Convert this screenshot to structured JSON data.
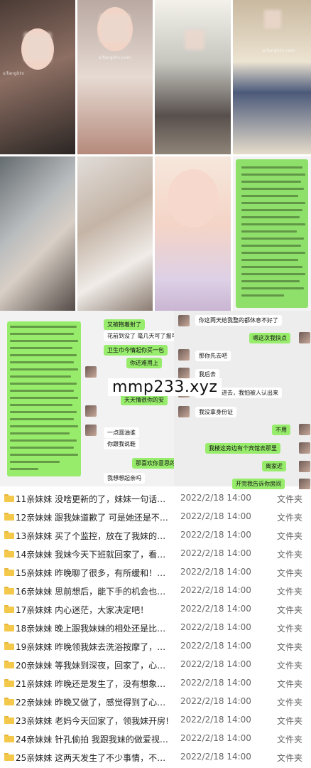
{
  "watermarks": [
    "sifangktv",
    "sifangktv.com",
    "sifangktv.com"
  ],
  "chat": {
    "left_bubbles": [
      "又被抱着射了",
      "花前到没了 毫几天可了报可能的",
      "卫生巾今情起你买一包",
      "你还难用上",
      "天天情很你的安",
      "一点圆油谁",
      "你跟我说鞋",
      "那喜欢你意思的",
      "我想想起亲吗"
    ],
    "right_bubbles": [
      "你这两天给我整的都休息不好了",
      "嗯这次我快点",
      "那你先去吧",
      "我后去",
      "咱俩一起进去，我怕被人认出来",
      "我没拿身份证",
      "不用",
      "我楼这旁边有个宾馆去那里",
      "离家近",
      "开完我告诉你房间"
    ]
  },
  "overlay_domain": "mmp233.xyz",
  "folders": [
    {
      "name": "11亲妹妹 没啥更新的了，妹妹一句话不跟我说...",
      "date": "2022/2/18 14:00",
      "type": "文件夹"
    },
    {
      "name": "12亲妹妹 跟我妹道歉了 可是她还是不说话",
      "date": "2022/2/18 14:00",
      "type": "文件夹"
    },
    {
      "name": "13亲妹妹 买了个监控，放在了我妹的卧室",
      "date": "2022/2/18 14:00",
      "type": "文件夹"
    },
    {
      "name": "14亲妹妹 我妹今天下班就回家了，看起来很憔悴",
      "date": "2022/2/18 14:00",
      "type": "文件夹"
    },
    {
      "name": "15亲妹妹 昨晚聊了很多，有所缓和！求大神继...",
      "date": "2022/2/18 14:00",
      "type": "文件夹"
    },
    {
      "name": "16亲妹妹 思前想后，能下手的机会也就是让我...",
      "date": "2022/2/18 14:00",
      "type": "文件夹"
    },
    {
      "name": "17亲妹妹 内心迷茫，大家决定吧！",
      "date": "2022/2/18 14:00",
      "type": "文件夹"
    },
    {
      "name": "18亲妹妹 晚上跟我妹妹的相处还是比较融洽的！",
      "date": "2022/2/18 14:00",
      "type": "文件夹"
    },
    {
      "name": "19亲妹妹 昨晚领我妹去洗浴按摩了，放松心情！",
      "date": "2022/2/18 14:00",
      "type": "文件夹"
    },
    {
      "name": "20亲妹妹 等我妹到深夜，回家了，心才落了地...",
      "date": "2022/2/18 14:00",
      "type": "文件夹"
    },
    {
      "name": "21亲妹妹 昨晚还是发生了，没有想象的那么刺...",
      "date": "2022/2/18 14:00",
      "type": "文件夹"
    },
    {
      "name": "22亲妹妹 昨晚又做了，感觉得到了心里也不是...",
      "date": "2022/2/18 14:00",
      "type": "文件夹"
    },
    {
      "name": "23亲妹妹 老妈今天回家了，领我妹开房!",
      "date": "2022/2/18 14:00",
      "type": "文件夹"
    },
    {
      "name": "24亲妹妹 针孔偷拍 我跟我妹的做爱视频露脸完...",
      "date": "2022/2/18 14:00",
      "type": "文件夹"
    },
    {
      "name": "25亲妹妹 这两天发生了不少事情，不过我很好",
      "date": "2022/2/18 14:00",
      "type": "文件夹"
    }
  ]
}
